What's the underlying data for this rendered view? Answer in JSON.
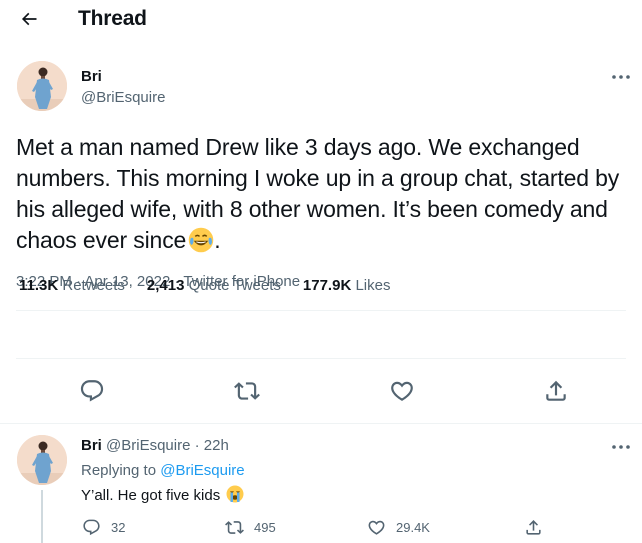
{
  "header": {
    "title": "Thread",
    "back_icon": "arrow-left-icon"
  },
  "tweet": {
    "author_name": "Bri",
    "author_handle": "@BriEsquire",
    "text": "Met a man named Drew like 3 days ago. We exchanged numbers. This morning I woke up in a group chat, started by his alleged wife, with 8 other women. It’s been comedy and chaos ever since",
    "text_suffix": ".",
    "emoji": "face-with-tears-of-joy",
    "time": "3:22 PM",
    "separator": "·",
    "date": "Apr 13, 2022",
    "source": "Twitter for iPhone",
    "stats": {
      "retweets_count": "11.3K",
      "retweets_label": "Retweets",
      "quotes_count": "2,413",
      "quotes_label": "Quote Tweets",
      "likes_count": "177.9K",
      "likes_label": "Likes"
    },
    "actions": [
      "reply-icon",
      "retweet-icon",
      "like-icon",
      "share-icon"
    ]
  },
  "reply": {
    "author_name": "Bri",
    "author_handle": "@BriEsquire",
    "separator": "·",
    "age": "22h",
    "replying_to_label": "Replying to",
    "replying_to_handle": "@BriEsquire",
    "text": "Y’all. He got five kids",
    "emoji": "loudly-crying-face",
    "reply_count": "32",
    "retweet_count": "495",
    "like_count": "29.4K"
  },
  "colors": {
    "text": "#0f1419",
    "muted": "#536471",
    "accent": "#1d9bf0",
    "divider": "#eff3f4"
  }
}
